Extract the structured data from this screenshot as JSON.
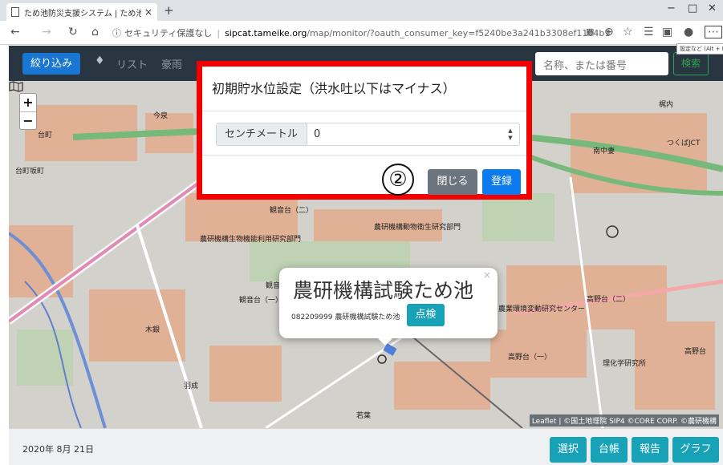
{
  "browser": {
    "tab_title": "ため池防災支援システム | ため池管",
    "tab_close": "×",
    "new_tab": "+",
    "url_info": "ⓘ",
    "url_security": "セキュリティ保護なし",
    "url_separator": "|",
    "url_host": "sipcat.tameike.org",
    "url_path": "/map/monitor/?oauth_consumer_key=f5240be3a241b3308ef1104b13a85e33...",
    "settings_tooltip": "設定など (Alt + F)",
    "icons": [
      "back-icon",
      "forward-icon",
      "refresh-icon",
      "home-icon",
      "reading-view-icon",
      "zoom-icon",
      "favorite-icon",
      "favorites-list-icon",
      "collections-icon",
      "profile-icon",
      "more-icon"
    ]
  },
  "navbar": {
    "filter_label": "絞り込み",
    "nav_items": [
      "リスト",
      "豪雨"
    ],
    "search_placeholder": "名称、または番号",
    "search_label": "検索"
  },
  "modal": {
    "title": "初期貯水位設定（洪水吐以下はマイナス）",
    "input_label": "センチメートル",
    "input_value": "0",
    "step_marker": "②",
    "close_label": "閉じる",
    "save_label": "登録",
    "highlight_color": "#f40000"
  },
  "map": {
    "zoom_in": "+",
    "zoom_out": "−",
    "labels": {
      "konsen": "今泉",
      "daimachi": "台町",
      "daimachi_zaka": "台町坂町",
      "kajiuchi": "梶内",
      "tsukuba_jct": "つくばJCT",
      "minami_nakazuma": "南中妻",
      "kannondai_2_upper": "観音台（二）",
      "bio_lab": "農研機構生物機能利用研究部門",
      "animal_lab": "農研機構動物衛生研究部門",
      "kannondai_2_lower": "観音台（二）",
      "kannondai_1": "観音台（一）",
      "env_lab": "農業環境変動研究センター",
      "takanodai_2": "高野台（二）",
      "takanodai_1": "高野台（一）",
      "riken_lab": "理化学研究所",
      "takano": "高野台",
      "haneda": "羽成",
      "wakaba": "若葉",
      "kigane": "木銀"
    },
    "popup": {
      "title": "農研機構試験ため池",
      "subtitle": "082209999 農研機構試験ため池",
      "inspect_label": "点検",
      "close": "×"
    },
    "attribution": "Leaflet | ©国土地理院 SIP4 ©CORE CORP. ©農研機構"
  },
  "footer": {
    "date": "2020年 8月 21日",
    "buttons": [
      "選択",
      "台帳",
      "報告",
      "グラフ"
    ]
  }
}
